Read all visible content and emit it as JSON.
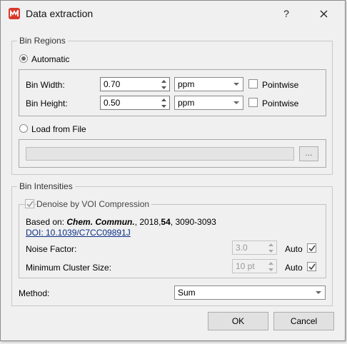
{
  "window": {
    "title": "Data extraction",
    "help_label": "?",
    "close_icon": "close-icon",
    "app_icon": "mnova-logo-icon",
    "app_icon_color": "#d9392b"
  },
  "bin_regions": {
    "legend": "Bin Regions",
    "automatic_label": "Automatic",
    "automatic_selected": true,
    "bin_width": {
      "label": "Bin Width:",
      "value": "0.70",
      "unit": "ppm",
      "pointwise_label": "Pointwise",
      "pointwise_checked": false
    },
    "bin_height": {
      "label": "Bin Height:",
      "value": "0.50",
      "unit": "ppm",
      "pointwise_label": "Pointwise",
      "pointwise_checked": false
    },
    "load_from_file_label": "Load from File",
    "load_from_file_selected": false,
    "file_path": "",
    "browse_label": "..."
  },
  "bin_intensities": {
    "legend": "Bin Intensities",
    "denoise_label": "Denoise by VOI Compression",
    "denoise_checked": true,
    "reference": {
      "prefix": "Based on: ",
      "journal": "Chem. Commun.",
      "year_sep": ", 2018,",
      "volume": "54",
      "pages": ", 3090-3093",
      "doi": "DOI: 10.1039/C7CC09891J"
    },
    "noise_factor": {
      "label": "Noise Factor:",
      "value": "3.0",
      "auto_label": "Auto",
      "auto_checked": true
    },
    "min_cluster": {
      "label": "Minimum Cluster Size:",
      "value": "10 pt",
      "auto_label": "Auto",
      "auto_checked": true
    },
    "method": {
      "label": "Method:",
      "value": "Sum"
    }
  },
  "buttons": {
    "ok": "OK",
    "cancel": "Cancel"
  }
}
